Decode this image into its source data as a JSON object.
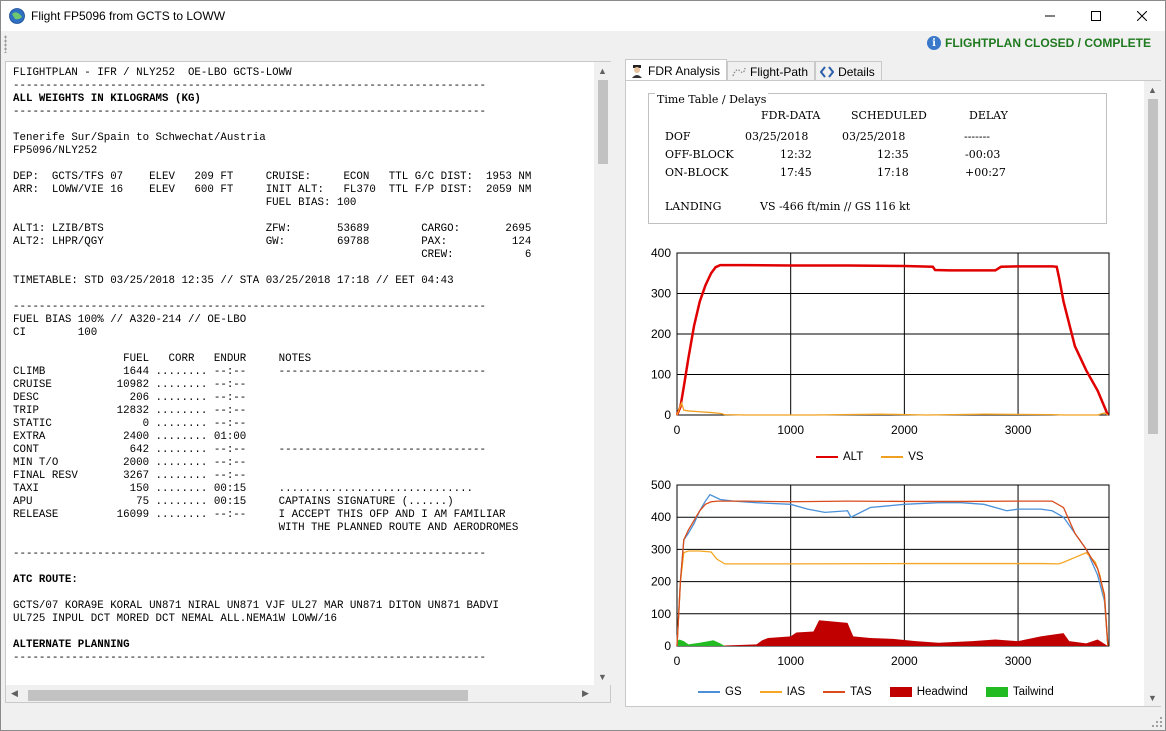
{
  "window": {
    "title": "Flight FP5096 from GCTS to LOWW",
    "status": "FLIGHTPLAN CLOSED / COMPLETE"
  },
  "ofp": {
    "lines": [
      {
        "t": "FLIGHTPLAN - IFR / NLY252  OE-LBO GCTS-LOWW",
        "b": false
      },
      {
        "t": "-------------------------------------------------------------------------",
        "b": false
      },
      {
        "t": "ALL WEIGHTS IN KILOGRAMS (KG)",
        "b": true
      },
      {
        "t": "-------------------------------------------------------------------------",
        "b": false
      },
      {
        "t": "",
        "b": false
      },
      {
        "t": "Tenerife Sur/Spain to Schwechat/Austria",
        "b": false
      },
      {
        "t": "FP5096/NLY252",
        "b": false
      },
      {
        "t": "",
        "b": false
      },
      {
        "t": "DEP:  GCTS/TFS 07    ELEV   209 FT     CRUISE:     ECON   TTL G/C DIST:  1953 NM",
        "b": false
      },
      {
        "t": "ARR:  LOWW/VIE 16    ELEV   600 FT     INIT ALT:   FL370  TTL F/P DIST:  2059 NM",
        "b": false
      },
      {
        "t": "                                       FUEL BIAS: 100",
        "b": false
      },
      {
        "t": "",
        "b": false
      },
      {
        "t": "ALT1: LZIB/BTS                         ZFW:       53689        CARGO:       2695",
        "b": false
      },
      {
        "t": "ALT2: LHPR/QGY                         GW:        69788        PAX:          124",
        "b": false
      },
      {
        "t": "                                                               CREW:           6",
        "b": false
      },
      {
        "t": "",
        "b": false
      },
      {
        "t": "TIMETABLE: STD 03/25/2018 12:35 // STA 03/25/2018 17:18 // EET 04:43",
        "b": false
      },
      {
        "t": "",
        "b": false
      },
      {
        "t": "-------------------------------------------------------------------------",
        "b": false
      },
      {
        "t": "FUEL BIAS 100% // A320-214 // OE-LBO",
        "b": false
      },
      {
        "t": "CI        100",
        "b": false
      },
      {
        "t": "",
        "b": false
      },
      {
        "t": "                 FUEL   CORR   ENDUR     NOTES",
        "b": false
      },
      {
        "t": "CLIMB            1644 ........ --:--     --------------------------------",
        "b": false
      },
      {
        "t": "CRUISE          10982 ........ --:--",
        "b": false
      },
      {
        "t": "DESC              206 ........ --:--",
        "b": false
      },
      {
        "t": "TRIP            12832 ........ --:--",
        "b": false
      },
      {
        "t": "STATIC              0 ........ --:--",
        "b": false
      },
      {
        "t": "EXTRA            2400 ........ 01:00",
        "b": false
      },
      {
        "t": "CONT              642 ........ --:--     --------------------------------",
        "b": false
      },
      {
        "t": "MIN T/O          2000 ........ --:--",
        "b": false
      },
      {
        "t": "FINAL RESV       3267 ........ --:--",
        "b": false
      },
      {
        "t": "TAXI              150 ........ 00:15     ..............................",
        "b": false
      },
      {
        "t": "APU                75 ........ 00:15     CAPTAINS SIGNATURE (......)",
        "b": false
      },
      {
        "t": "RELEASE         16099 ........ --:--     I ACCEPT THIS OFP AND I AM FAMILIAR",
        "b": false
      },
      {
        "t": "                                         WITH THE PLANNED ROUTE AND AERODROMES",
        "b": false
      },
      {
        "t": "",
        "b": false
      },
      {
        "t": "-------------------------------------------------------------------------",
        "b": false
      },
      {
        "t": "",
        "b": false
      },
      {
        "t": "ATC ROUTE:",
        "b": true
      },
      {
        "t": "",
        "b": false
      },
      {
        "t": "GCTS/07 KORA9E KORAL UN871 NIRAL UN871 VJF UL27 MAR UN871 DITON UN871 BADVI",
        "b": false
      },
      {
        "t": "UL725 INPUL DCT MORED DCT NEMAL ALL.NEMA1W LOWW/16",
        "b": false
      },
      {
        "t": "",
        "b": false
      },
      {
        "t": "ALTERNATE PLANNING",
        "b": true
      },
      {
        "t": "-------------------------------------------------------------------------",
        "b": false
      }
    ]
  },
  "tabs": [
    {
      "label": "FDR Analysis",
      "icon": "pilot-icon"
    },
    {
      "label": "Flight-Path",
      "icon": "dotted-path-icon"
    },
    {
      "label": "Details",
      "icon": "code-brackets-icon"
    }
  ],
  "timetable": {
    "title": "Time Table / Delays",
    "headers": [
      "FDR-DATA",
      "SCHEDULED",
      "DELAY"
    ],
    "rows": [
      {
        "label": "DOF",
        "fdr": "03/25/2018",
        "sched": "03/25/2018",
        "delay": "-------"
      },
      {
        "label": "OFF-BLOCK",
        "fdr": "12:32",
        "sched": "12:35",
        "delay": "-00:03"
      },
      {
        "label": "ON-BLOCK",
        "fdr": "17:45",
        "sched": "17:18",
        "delay": "+00:27"
      }
    ],
    "landing_label": "LANDING",
    "landing_value": "VS -466 ft/min // GS 116 kt"
  },
  "colors": {
    "alt": "#e00000",
    "vs": "#f0a020",
    "gs": "#4a90d9",
    "ias": "#f5a623",
    "tas": "#d94c1a",
    "headwind": "#c00000",
    "tailwind": "#22bb22"
  },
  "chart_data": [
    {
      "type": "line",
      "xlim": [
        0,
        3800
      ],
      "ylim": [
        0,
        400
      ],
      "xticks": [
        0,
        1000,
        2000,
        3000
      ],
      "yticks": [
        0,
        100,
        200,
        300,
        400
      ],
      "legend": "bottom",
      "series": [
        {
          "name": "ALT",
          "x": [
            0,
            30,
            60,
            100,
            150,
            200,
            250,
            300,
            340,
            380,
            420,
            600,
            1000,
            1500,
            2000,
            2250,
            2270,
            2400,
            2800,
            2850,
            3000,
            3300,
            3340,
            3360,
            3400,
            3500,
            3600,
            3700,
            3760,
            3790
          ],
          "y": [
            0,
            20,
            70,
            140,
            220,
            280,
            320,
            350,
            365,
            370,
            370,
            370,
            369,
            369,
            368,
            366,
            358,
            357,
            357,
            366,
            367,
            367,
            366,
            340,
            280,
            170,
            110,
            60,
            20,
            0
          ]
        },
        {
          "name": "VS",
          "x": [
            0,
            40,
            60,
            100,
            200,
            300,
            380,
            420,
            600,
            1200,
            1800,
            2200,
            2700,
            3300,
            3400,
            3600,
            3700,
            3760,
            3790
          ],
          "y": [
            0,
            30,
            12,
            10,
            8,
            6,
            4,
            1,
            0,
            0,
            2,
            0,
            2,
            1,
            0,
            0,
            0,
            5,
            0
          ]
        }
      ]
    },
    {
      "type": "line",
      "xlim": [
        0,
        3800
      ],
      "ylim": [
        0,
        500
      ],
      "xticks": [
        0,
        1000,
        2000,
        3000
      ],
      "yticks": [
        0,
        100,
        200,
        300,
        400,
        500
      ],
      "legend": "bottom",
      "series": [
        {
          "name": "GS",
          "x": [
            0,
            30,
            60,
            100,
            150,
            200,
            250,
            290,
            320,
            380,
            500,
            700,
            1000,
            1150,
            1300,
            1500,
            1530,
            1700,
            2000,
            2300,
            2500,
            2700,
            2900,
            3000,
            3200,
            3300,
            3400,
            3500,
            3600,
            3700,
            3760,
            3790
          ],
          "y": [
            0,
            200,
            330,
            350,
            380,
            420,
            450,
            470,
            465,
            455,
            450,
            445,
            440,
            425,
            415,
            420,
            400,
            430,
            440,
            445,
            445,
            440,
            420,
            425,
            425,
            420,
            400,
            350,
            300,
            220,
            140,
            0
          ]
        },
        {
          "name": "IAS",
          "x": [
            0,
            30,
            60,
            100,
            200,
            300,
            350,
            420,
            1000,
            2000,
            3000,
            3200,
            3360,
            3400,
            3500,
            3600,
            3680,
            3720,
            3760,
            3790
          ],
          "y": [
            0,
            200,
            290,
            295,
            295,
            292,
            270,
            255,
            255,
            256,
            256,
            256,
            255,
            260,
            275,
            290,
            260,
            220,
            150,
            0
          ]
        },
        {
          "name": "TAS",
          "x": [
            0,
            30,
            60,
            100,
            150,
            200,
            250,
            300,
            360,
            420,
            600,
            1000,
            1500,
            2000,
            2500,
            3000,
            3300,
            3400,
            3500,
            3600,
            3700,
            3760,
            3790
          ],
          "y": [
            0,
            200,
            330,
            360,
            390,
            420,
            440,
            448,
            450,
            450,
            450,
            448,
            450,
            449,
            449,
            450,
            450,
            430,
            350,
            300,
            240,
            160,
            0
          ]
        },
        {
          "name": "Headwind",
          "x": [
            0,
            300,
            700,
            750,
            800,
            1000,
            1050,
            1200,
            1250,
            1500,
            1550,
            1700,
            1900,
            2100,
            2300,
            2600,
            2800,
            3000,
            3200,
            3400,
            3450,
            3600,
            3700,
            3790
          ],
          "y": [
            0,
            0,
            5,
            18,
            25,
            30,
            42,
            45,
            80,
            72,
            30,
            25,
            22,
            15,
            10,
            15,
            20,
            15,
            30,
            40,
            15,
            8,
            20,
            0
          ]
        },
        {
          "name": "Tailwind",
          "x": [
            0,
            20,
            60,
            100,
            200,
            280,
            320,
            380,
            420,
            2000,
            3790
          ],
          "y": [
            15,
            20,
            15,
            5,
            10,
            15,
            18,
            8,
            0,
            0,
            0
          ]
        }
      ]
    }
  ]
}
